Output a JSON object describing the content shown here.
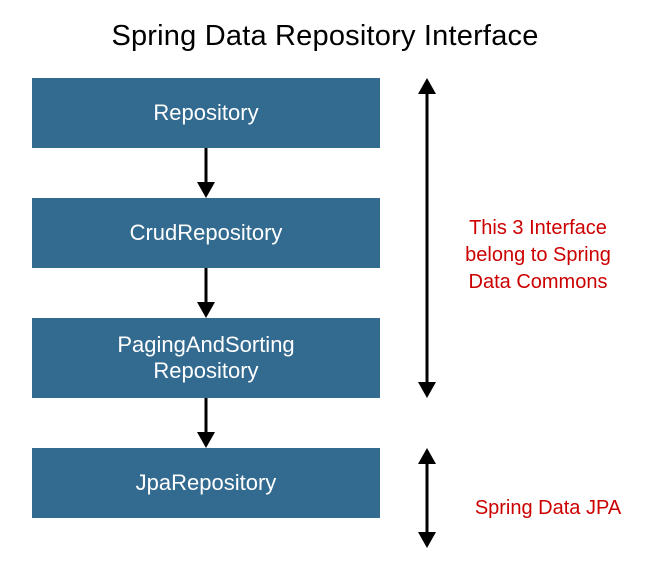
{
  "title": "Spring Data Repository Interface",
  "boxes": {
    "b1": "Repository",
    "b2": "CrudRepository",
    "b3_line1": "PagingAndSorting",
    "b3_line2": "Repository",
    "b4": "JpaRepository"
  },
  "annotations": {
    "a1_line1": "This 3 Interface",
    "a1_line2": "belong to Spring",
    "a1_line3": "Data Commons",
    "a2": "Spring Data JPA"
  },
  "colors": {
    "box_bg": "#336a90",
    "box_text": "#ffffff",
    "annotation": "#cc0000"
  }
}
